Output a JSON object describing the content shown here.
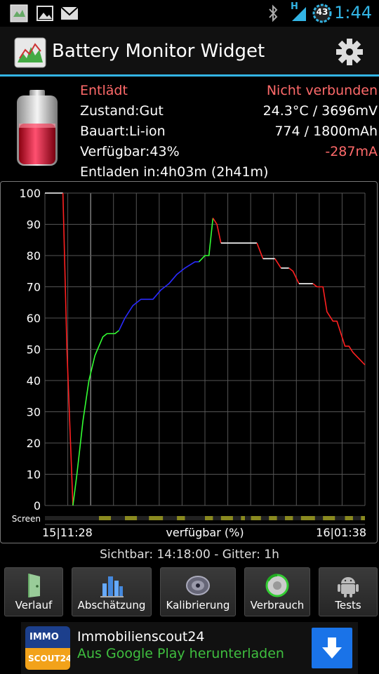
{
  "status_bar": {
    "time": "1:44",
    "battery_level": "43",
    "network": "H",
    "icons": [
      "app-notification-icon",
      "image-icon",
      "mail-icon",
      "bluetooth-icon",
      "signal-icon",
      "battery-icon"
    ]
  },
  "header": {
    "title": "Battery Monitor Widget",
    "settings_icon": "gear-icon"
  },
  "info": {
    "status": "Entlädt",
    "connection": "Nicht verbunden",
    "condition": "Zustand:Gut",
    "temp_voltage": "24.3°C / 3696mV",
    "type": "Bauart:Li-ion",
    "capacity": "774 / 1800mAh",
    "available": "Verfügbar:43%",
    "current": "-287mA",
    "discharge_time": "Entladen in:4h03m (2h41m)"
  },
  "chart_data": {
    "type": "line",
    "y_ticks": [
      "100",
      "90",
      "80",
      "70",
      "60",
      "50",
      "40",
      "30",
      "20",
      "10",
      "0"
    ],
    "ylim": [
      0,
      100
    ],
    "x_label_left": "15|11:28",
    "x_label_right": "16|01:38",
    "xlabel": "verfügbar (%)",
    "screen_label": "Screen",
    "grid": true,
    "colors": {
      "discharge": "#ff2020",
      "charge_ac": "#33ff33",
      "charge_usb": "#2a2aff",
      "idle": "#ffffff"
    },
    "series": [
      {
        "color": "#ffffff",
        "points": [
          [
            0,
            100
          ],
          [
            0.9,
            100
          ]
        ]
      },
      {
        "color": "#ff2020",
        "points": [
          [
            0.9,
            100
          ],
          [
            1.1,
            50
          ],
          [
            1.4,
            0
          ]
        ]
      },
      {
        "color": "#33ff33",
        "points": [
          [
            1.4,
            0
          ],
          [
            1.6,
            10
          ],
          [
            1.9,
            27
          ],
          [
            2.2,
            40
          ],
          [
            2.5,
            48
          ],
          [
            2.9,
            54
          ],
          [
            3.1,
            55
          ],
          [
            3.5,
            55
          ],
          [
            3.7,
            56
          ]
        ]
      },
      {
        "color": "#2a2aff",
        "points": [
          [
            3.7,
            56
          ],
          [
            4.0,
            60
          ],
          [
            4.4,
            64
          ],
          [
            4.8,
            66
          ],
          [
            5.4,
            66
          ],
          [
            5.8,
            69
          ],
          [
            6.2,
            71
          ],
          [
            6.6,
            74
          ],
          [
            7.0,
            76
          ],
          [
            7.5,
            78
          ],
          [
            7.7,
            78
          ]
        ]
      },
      {
        "color": "#33ff33",
        "points": [
          [
            7.7,
            78
          ],
          [
            8.0,
            80
          ],
          [
            8.2,
            80
          ],
          [
            8.4,
            92
          ]
        ]
      },
      {
        "color": "#ff2020",
        "points": [
          [
            8.4,
            92
          ],
          [
            8.6,
            90
          ],
          [
            8.8,
            84
          ]
        ]
      },
      {
        "color": "#ffffff",
        "points": [
          [
            8.8,
            84
          ],
          [
            10.6,
            84
          ]
        ]
      },
      {
        "color": "#ff2020",
        "points": [
          [
            10.6,
            84
          ],
          [
            10.9,
            79
          ]
        ]
      },
      {
        "color": "#ffffff",
        "points": [
          [
            10.9,
            79
          ],
          [
            11.5,
            79
          ]
        ]
      },
      {
        "color": "#ff2020",
        "points": [
          [
            11.5,
            79
          ],
          [
            11.8,
            76
          ]
        ]
      },
      {
        "color": "#ffffff",
        "points": [
          [
            11.8,
            76
          ],
          [
            12.2,
            76
          ]
        ]
      },
      {
        "color": "#ff2020",
        "points": [
          [
            12.2,
            76
          ],
          [
            12.4,
            75
          ],
          [
            12.7,
            71
          ]
        ]
      },
      {
        "color": "#ffffff",
        "points": [
          [
            12.7,
            71
          ],
          [
            13.4,
            71
          ]
        ]
      },
      {
        "color": "#ff2020",
        "points": [
          [
            13.4,
            71
          ],
          [
            13.6,
            70
          ],
          [
            13.9,
            70
          ],
          [
            14.1,
            62
          ],
          [
            14.4,
            59
          ],
          [
            14.6,
            59
          ],
          [
            14.8,
            55
          ],
          [
            15.0,
            51
          ],
          [
            15.2,
            51
          ],
          [
            15.4,
            49
          ],
          [
            15.7,
            47
          ],
          [
            16.0,
            45
          ]
        ]
      }
    ],
    "screen_on_segments": [
      [
        2.7,
        3.3
      ],
      [
        4.0,
        4.6
      ],
      [
        5.2,
        5.9
      ],
      [
        6.6,
        7.0
      ],
      [
        8.0,
        8.4
      ],
      [
        8.8,
        9.4
      ],
      [
        9.8,
        10.0
      ],
      [
        10.3,
        10.8
      ],
      [
        11.2,
        11.6
      ],
      [
        12.0,
        12.4
      ],
      [
        12.8,
        13.5
      ],
      [
        13.9,
        14.5
      ],
      [
        15.0,
        15.4
      ],
      [
        15.8,
        16.0
      ]
    ],
    "x_range": [
      0,
      16
    ]
  },
  "footer": {
    "visible_info": "Sichtbar: 14:18:00 - Gitter: 1h"
  },
  "toolbar": {
    "buttons": [
      {
        "label": "Verlauf",
        "icon": "door-icon"
      },
      {
        "label": "Abschätzung",
        "icon": "city-chart-icon"
      },
      {
        "label": "Kalibrierung",
        "icon": "compass-icon"
      },
      {
        "label": "Verbrauch",
        "icon": "recycle-disc-icon"
      },
      {
        "label": "Tests",
        "icon": "android-icon"
      }
    ]
  },
  "ad": {
    "logo_line1": "IMMO",
    "logo_line2": "SCOUT24",
    "title": "Immobilienscout24",
    "subtitle": "Aus Google Play herunterladen",
    "download_icon": "download-arrow-icon"
  }
}
